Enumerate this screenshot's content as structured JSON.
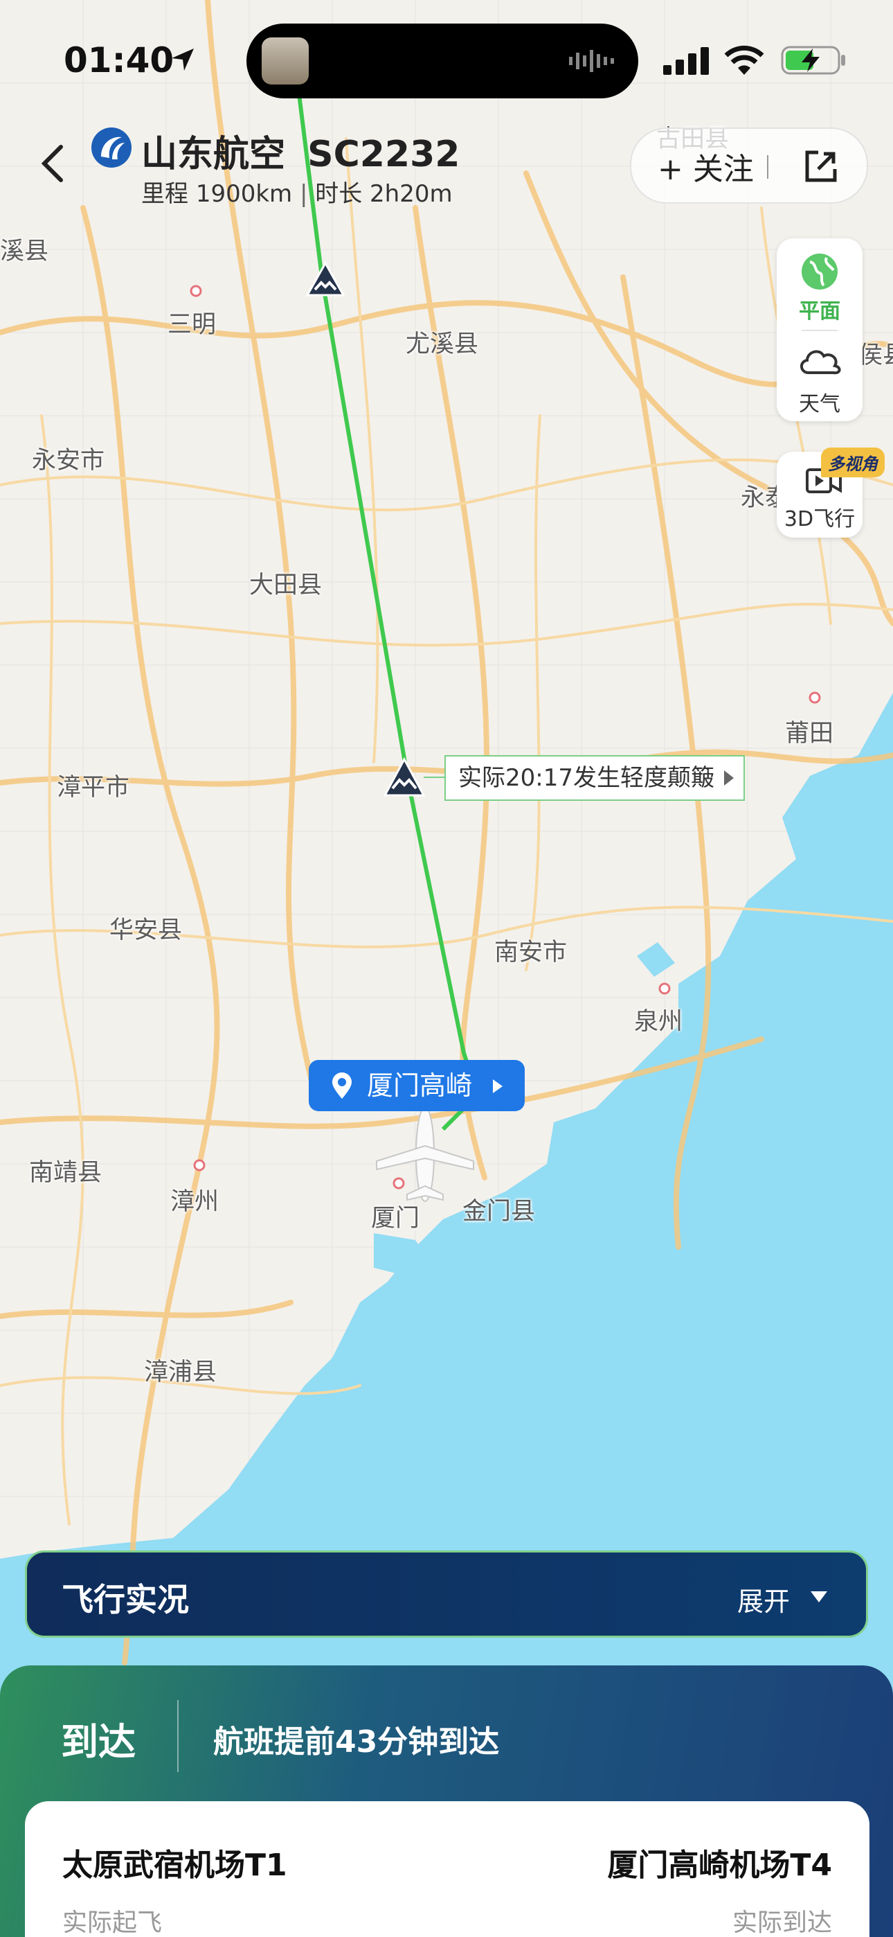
{
  "status_bar": {
    "time": "01:40"
  },
  "header": {
    "airline": "山东航空",
    "flight_no": "SC2232",
    "distance_label": "里程",
    "distance": "1900km",
    "duration_label": "时长",
    "duration": "2h20m",
    "follow_label": "+ 关注"
  },
  "side_controls": {
    "plane_label": "平面",
    "weather_label": "天气",
    "fly3d_label": "3D飞行",
    "multi_view_badge": "多视角"
  },
  "map": {
    "places": [
      {
        "name": "三明"
      },
      {
        "name": "尤溪县"
      },
      {
        "name": "永安市"
      },
      {
        "name": "大田县"
      },
      {
        "name": "莆田"
      },
      {
        "name": "漳平市"
      },
      {
        "name": "华安县"
      },
      {
        "name": "南安市"
      },
      {
        "name": "泉州"
      },
      {
        "name": "南靖县"
      },
      {
        "name": "漳州"
      },
      {
        "name": "厦门"
      },
      {
        "name": "金门县"
      },
      {
        "name": "漳浦县"
      },
      {
        "name": "古田县"
      },
      {
        "name": "溪县"
      },
      {
        "name": "侯县"
      },
      {
        "name": "永泰"
      }
    ],
    "turbulence_note": "实际20:17发生轻度颠簸",
    "airport_pill": "厦门高崎",
    "colors": {
      "route": "#3fc94e",
      "sea": "#92dcf4",
      "land": "#f3f1ec",
      "road": "#f5c77e"
    }
  },
  "live_panel": {
    "title": "飞行实况",
    "expand_label": "展开"
  },
  "arrival": {
    "status": "到达",
    "message": "航班提前43分钟到达",
    "departure_airport": "太原武宿机场T1",
    "arrival_airport": "厦门高崎机场T4",
    "departure_sub": "实际起飞",
    "arrival_sub": "实际到达"
  }
}
